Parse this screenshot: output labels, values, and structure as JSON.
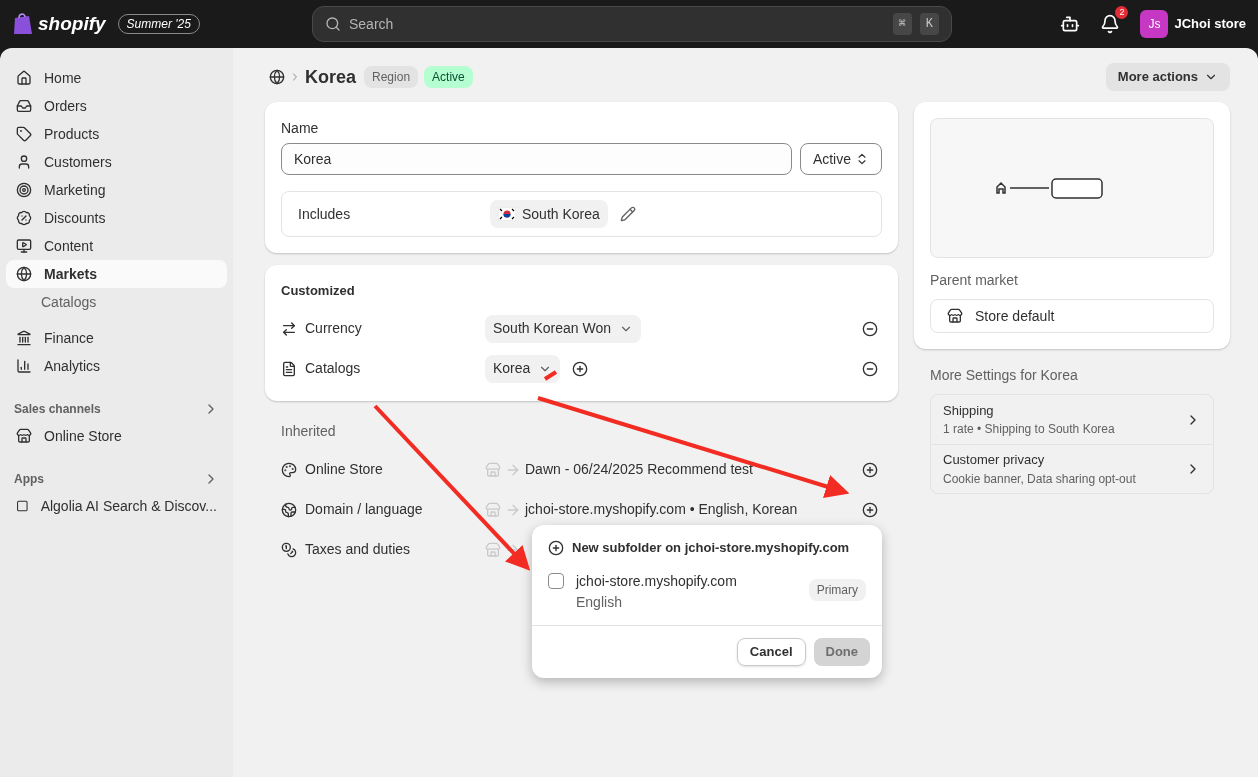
{
  "topbar": {
    "logo": "shopify",
    "edition": "Summer '25",
    "search": {
      "placeholder": "Search",
      "keys": [
        "⌘",
        "K"
      ]
    },
    "notifications": "2",
    "avatar": "Js",
    "store": "JChoi store"
  },
  "sidebar": {
    "items": [
      {
        "label": "Home",
        "selected": false
      },
      {
        "label": "Orders",
        "selected": false
      },
      {
        "label": "Products",
        "selected": false
      },
      {
        "label": "Customers",
        "selected": false
      },
      {
        "label": "Marketing",
        "selected": false
      },
      {
        "label": "Discounts",
        "selected": false
      },
      {
        "label": "Content",
        "selected": false
      },
      {
        "label": "Markets",
        "selected": true,
        "children": [
          {
            "label": "Catalogs",
            "selected": false
          }
        ]
      },
      {
        "label": "Finance",
        "selected": false
      },
      {
        "label": "Analytics",
        "selected": false
      }
    ],
    "sections": [
      {
        "title": "Sales channels",
        "items": [
          {
            "label": "Online Store"
          }
        ]
      },
      {
        "title": "Apps",
        "items": [
          {
            "label": "Algolia AI Search & Discov..."
          }
        ]
      }
    ]
  },
  "header": {
    "title": "Korea",
    "badges": [
      {
        "label": "Region",
        "kind": "neutral"
      },
      {
        "label": "Active",
        "kind": "success"
      }
    ],
    "more_actions": "More actions"
  },
  "name_card": {
    "label": "Name",
    "value": "Korea",
    "status": "Active",
    "includes_label": "Includes",
    "includes": "South Korea"
  },
  "customized": {
    "title": "Customized",
    "rows": [
      {
        "label": "Currency",
        "value": "South Korean Won",
        "add": false
      },
      {
        "label": "Catalogs",
        "value": "Korea",
        "add": true
      }
    ]
  },
  "inherited": {
    "title": "Inherited",
    "rows": [
      {
        "label": "Online Store",
        "value": "Dawn - 06/24/2025 Recommend test"
      },
      {
        "label": "Domain / language",
        "value": "jchoi-store.myshopify.com • English, Korean"
      },
      {
        "label": "Taxes and duties"
      }
    ]
  },
  "popover": {
    "new_subfolder": "New subfolder on jchoi-store.myshopify.com",
    "options": [
      {
        "domain": "jchoi-store.myshopify.com",
        "language": "English",
        "badge": "Primary",
        "checked": false
      }
    ],
    "cancel": "Cancel",
    "done": {
      "label": "Done",
      "disabled": true
    }
  },
  "parent_market": {
    "label": "Parent market",
    "value": "Store default"
  },
  "more_settings": {
    "title": "More Settings for Korea",
    "items": [
      {
        "title": "Shipping",
        "subtitle": "1 rate • Shipping to South Korea"
      },
      {
        "title": "Customer privacy",
        "subtitle": "Cookie banner, Data sharing opt-out"
      }
    ]
  }
}
